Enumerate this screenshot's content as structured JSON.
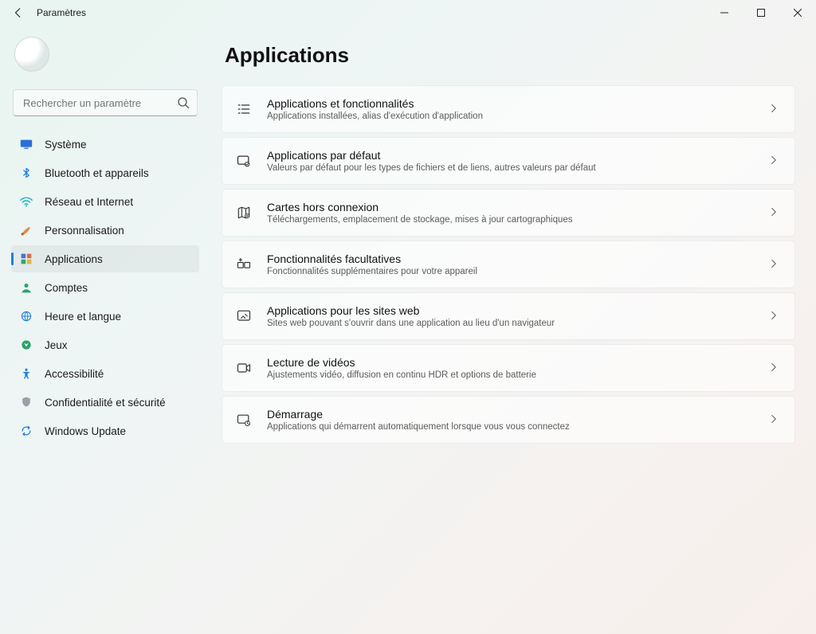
{
  "window": {
    "title": "Paramètres"
  },
  "search": {
    "placeholder": "Rechercher un paramètre"
  },
  "sidebar": {
    "items": [
      {
        "label": "Système"
      },
      {
        "label": "Bluetooth et appareils"
      },
      {
        "label": "Réseau et Internet"
      },
      {
        "label": "Personnalisation"
      },
      {
        "label": "Applications"
      },
      {
        "label": "Comptes"
      },
      {
        "label": "Heure et langue"
      },
      {
        "label": "Jeux"
      },
      {
        "label": "Accessibilité"
      },
      {
        "label": "Confidentialité et sécurité"
      },
      {
        "label": "Windows Update"
      }
    ],
    "selected_index": 4
  },
  "page": {
    "title": "Applications",
    "cards": [
      {
        "title": "Applications et fonctionnalités",
        "subtitle": "Applications installées, alias d'exécution d'application"
      },
      {
        "title": "Applications par défaut",
        "subtitle": "Valeurs par défaut pour les types de fichiers et de liens, autres valeurs par défaut"
      },
      {
        "title": "Cartes hors connexion",
        "subtitle": "Téléchargements, emplacement de stockage, mises à jour cartographiques"
      },
      {
        "title": "Fonctionnalités facultatives",
        "subtitle": "Fonctionnalités supplémentaires pour votre appareil"
      },
      {
        "title": "Applications pour les sites web",
        "subtitle": "Sites web pouvant s'ouvrir dans une application au lieu d'un navigateur"
      },
      {
        "title": "Lecture de vidéos",
        "subtitle": "Ajustements vidéo, diffusion en continu HDR et options de batterie"
      },
      {
        "title": "Démarrage",
        "subtitle": "Applications qui démarrent automatiquement lorsque vous vous connectez"
      }
    ]
  }
}
